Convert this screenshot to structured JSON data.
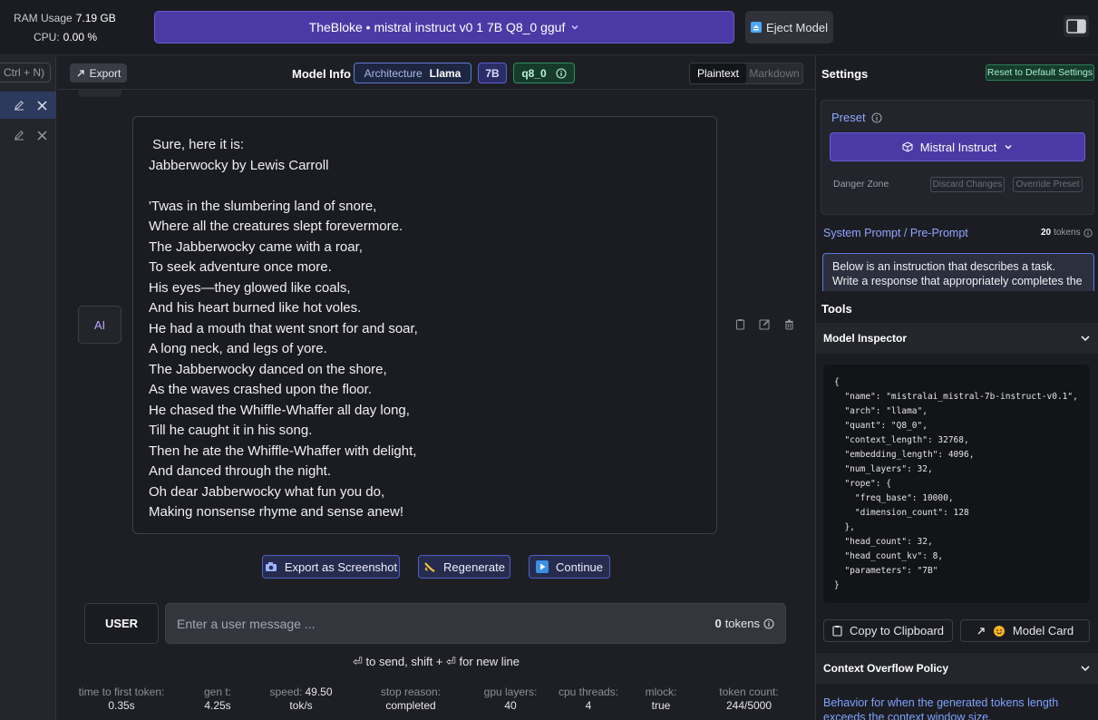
{
  "system": {
    "ram_label": "RAM Usage",
    "ram_value": "7.19 GB",
    "cpu_label": "CPU:",
    "cpu_value": "0.00 %"
  },
  "model_selector": {
    "label": "TheBloke • mistral instruct v0 1 7B Q8_0 gguf",
    "icon": "chevron-down-icon"
  },
  "eject_label": "Eject Model",
  "sidebar": {
    "new_chat_hint": "Ctrl + N)"
  },
  "header": {
    "export_label": "Export",
    "model_info_label": "Model Info",
    "architecture_label": "Architecture",
    "architecture_value": "Llama",
    "size_badge": "7B",
    "quant_badge": "q8_0",
    "format_options": [
      "Plaintext",
      "Markdown"
    ],
    "format_selected": "Plaintext"
  },
  "message": {
    "role": "AI",
    "lines": [
      " Sure, here it is:",
      "Jabberwocky by Lewis Carroll",
      "",
      "'Twas in the slumbering land of snore,",
      "Where all the creatures slept forevermore.",
      "The Jabberwocky came with a roar,",
      "To seek adventure once more.",
      "His eyes—they glowed like coals,",
      "And his heart burned like hot voles.",
      "He had a mouth that went snort for and soar,",
      "A long neck, and legs of yore.",
      "The Jabberwocky danced on the shore,",
      "As the waves crashed upon the floor.",
      "He chased the Whiffle-Whaffer all day long,",
      "Till he caught it in his song.",
      "Then he ate the Whiffle-Whaffer with delight,",
      "And danced through the night.",
      "Oh dear Jabberwocky what fun you do,",
      "Making nonsense rhyme and sense anew!"
    ]
  },
  "actions": {
    "screenshot_label": "Export as Screenshot",
    "regenerate_label": "Regenerate",
    "continue_label": "Continue"
  },
  "composer": {
    "role": "USER",
    "placeholder": "Enter a user message ...",
    "tokens": "0",
    "tokens_label": "tokens",
    "send_hint": "⏎ to send, shift + ⏎ for new line"
  },
  "stats": [
    {
      "label": "time to first token:",
      "value": "0.35s"
    },
    {
      "label": "gen t:",
      "value": "4.25s"
    },
    {
      "label": "speed:",
      "value": "49.50",
      "unit": "tok/s"
    },
    {
      "label": "stop reason:",
      "value": "completed"
    },
    {
      "label": "gpu layers:",
      "value": "40"
    },
    {
      "label": "cpu threads:",
      "value": "4"
    },
    {
      "label": "mlock:",
      "value": "true"
    },
    {
      "label": "token count:",
      "value": "244/5000"
    }
  ],
  "settings": {
    "title": "Settings",
    "reset_label": "Reset to Default Settings",
    "preset_label": "Preset",
    "preset_value": "Mistral Instruct",
    "danger_zone_label": "Danger Zone",
    "discard_label": "Discard Changes",
    "override_label": "Override Preset",
    "system_prompt_label": "System Prompt / Pre-Prompt",
    "system_prompt_tokens": "20",
    "system_prompt_tokens_label": "tokens",
    "system_prompt_text": "Below is an instruction that describes a task. Write a response that appropriately completes the request."
  },
  "tools": {
    "title": "Tools",
    "inspector_title": "Model Inspector",
    "inspector_json": "{\n  \"name\": \"mistralai_mistral-7b-instruct-v0.1\",\n  \"arch\": \"llama\",\n  \"quant\": \"Q8_0\",\n  \"context_length\": 32768,\n  \"embedding_length\": 4096,\n  \"num_layers\": 32,\n  \"rope\": {\n    \"freq_base\": 10000,\n    \"dimension_count\": 128\n  },\n  \"head_count\": 32,\n  \"head_count_kv\": 8,\n  \"parameters\": \"7B\"\n}",
    "copy_label": "Copy to Clipboard",
    "model_card_label": "Model Card",
    "overflow_title": "Context Overflow Policy",
    "overflow_desc": "Behavior for when the generated tokens length exceeds the context window size."
  },
  "colors": {
    "accent_purple": "#4b3aa6",
    "accent_blue": "#5a78d6",
    "accent_green": "#2e8e62",
    "background": "#1e1f24"
  }
}
